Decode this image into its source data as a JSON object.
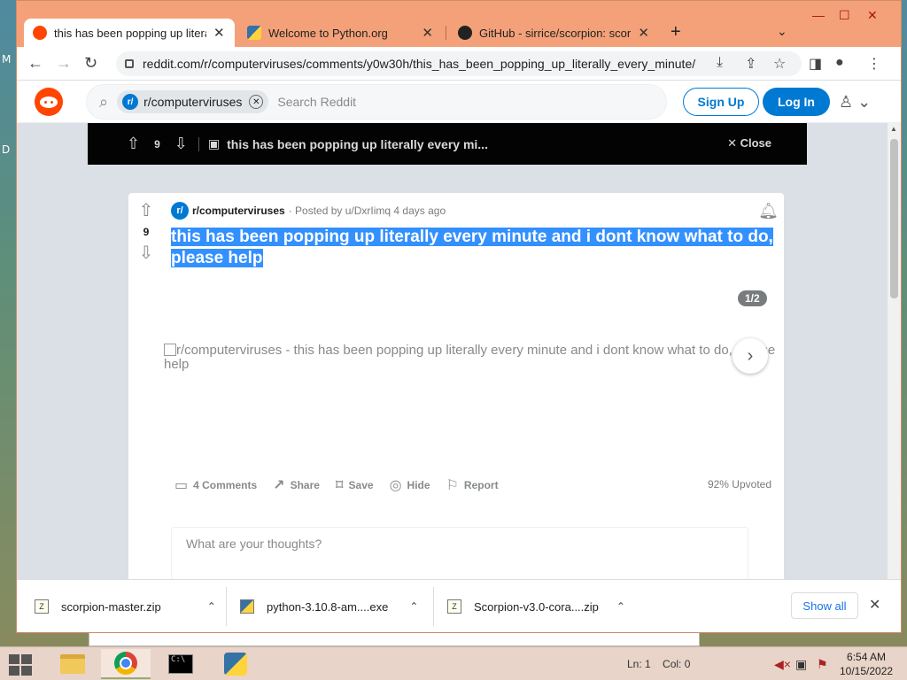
{
  "desktop": {
    "left_letters": [
      "M",
      "D"
    ]
  },
  "browser": {
    "tabs": [
      {
        "label": "this has been popping up literally every minute",
        "favicon": "reddit-icon",
        "active": true
      },
      {
        "label": "Welcome to Python.org",
        "favicon": "python-icon",
        "active": false
      },
      {
        "label": "GitHub - sirrice/scorpion: scorpion",
        "favicon": "github-icon",
        "active": false
      }
    ],
    "new_tab": "+",
    "tab_search": "⌄",
    "window_controls": {
      "minimize": "—",
      "maximize": "☐",
      "close": "✕"
    },
    "url": "reddit.com/r/computerviruses/comments/y0w30h/this_has_been_popping_up_literally_every_minute/"
  },
  "reddit": {
    "search_chip": "r/computerviruses",
    "search_placeholder": "Search Reddit",
    "signup": "Sign Up",
    "login": "Log In",
    "postbar": {
      "votes": "9",
      "title": "this has been popping up literally every mi...",
      "close": "Close"
    },
    "post": {
      "votes": "9",
      "subreddit": "r/computerviruses",
      "posted_by": "· Posted by u/DxrIimq 4 days ago",
      "title": "this has been popping up literally every minute and i dont know what to do, please help",
      "page_badge": "1/2",
      "image_alt": "r/computerviruses - this has been popping up literally every minute and i dont know what to do, please help",
      "actions": {
        "comments": "4 Comments",
        "share": "Share",
        "save": "Save",
        "hide": "Hide",
        "report": "Report"
      },
      "upvoted": "92% Upvoted",
      "comment_placeholder": "What are your thoughts?"
    }
  },
  "downloads": {
    "items": [
      "scorpion-master.zip",
      "python-3.10.8-am....exe",
      "Scorpion-v3.0-cora....zip"
    ],
    "show_all": "Show all"
  },
  "taskbar": {
    "editor_status": {
      "ln": "Ln: 1",
      "col": "Col: 0"
    },
    "time": "6:54 AM",
    "date": "10/15/2022"
  },
  "colors": {
    "reddit_orange": "#ff4500",
    "reddit_blue": "#0079d3",
    "selection": "#3390ff"
  }
}
